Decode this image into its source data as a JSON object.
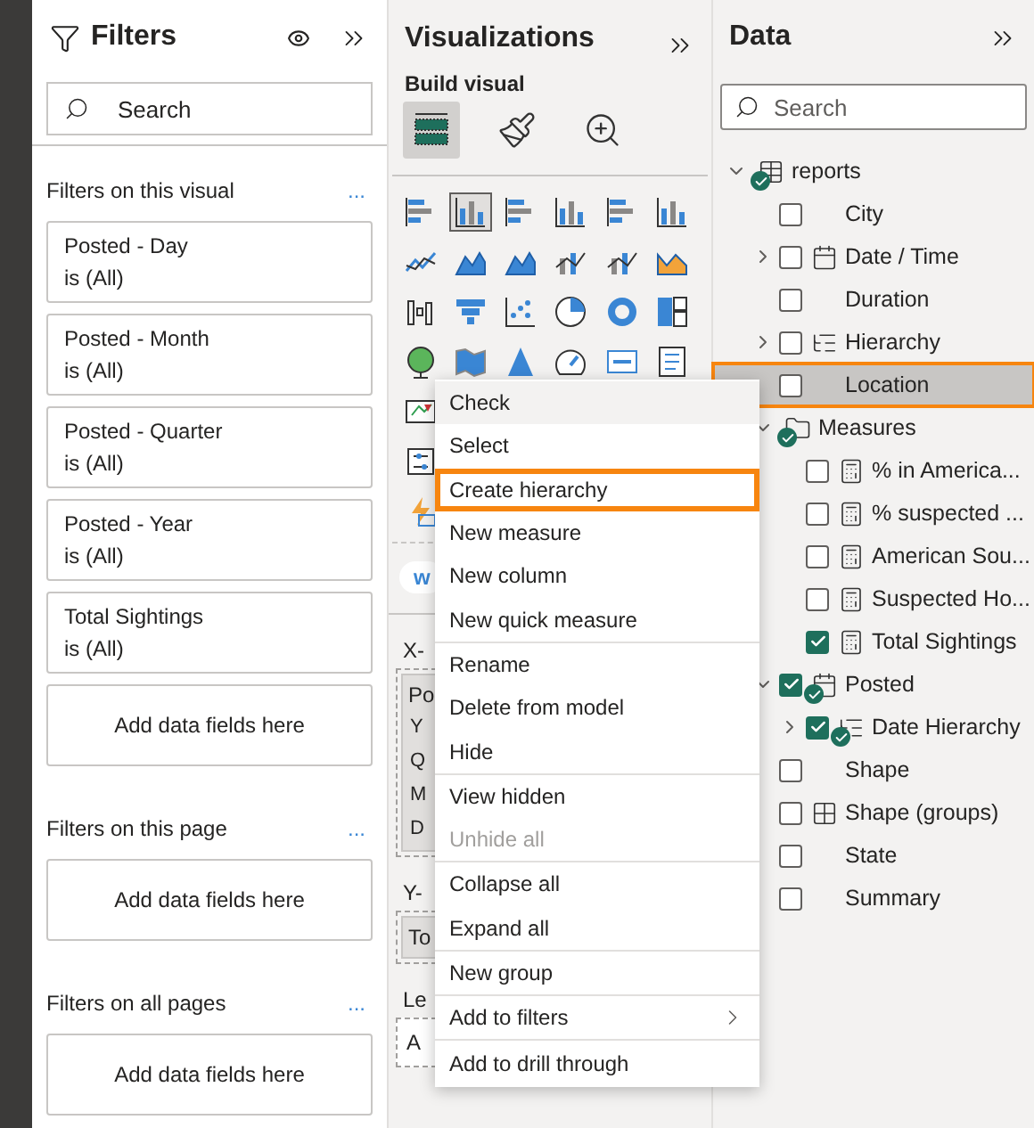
{
  "filters": {
    "title": "Filters",
    "search": {
      "placeholder": "Search"
    },
    "sections": [
      {
        "title": "Filters on this visual",
        "more": "...",
        "cards": [
          {
            "field": "Posted - Day",
            "condition": "is (All)"
          },
          {
            "field": "Posted - Month",
            "condition": "is (All)"
          },
          {
            "field": "Posted - Quarter",
            "condition": "is (All)"
          },
          {
            "field": "Posted - Year",
            "condition": "is (All)"
          },
          {
            "field": "Total Sightings",
            "condition": "is (All)"
          }
        ],
        "dropzone": "Add data fields here"
      },
      {
        "title": "Filters on this page",
        "more": "...",
        "dropzone": "Add data fields here"
      },
      {
        "title": "Filters on all pages",
        "more": "...",
        "dropzone": "Add data fields here"
      }
    ]
  },
  "visualizations": {
    "title": "Visualizations",
    "subtitle": "Build visual",
    "tabs": [
      {
        "kind": "fields",
        "selected": true
      },
      {
        "kind": "format",
        "selected": false
      },
      {
        "kind": "analytics",
        "selected": false
      }
    ],
    "visual_types": [
      [
        {
          "kind": "hbar",
          "selected": false
        },
        {
          "kind": "column",
          "selected": true
        },
        {
          "kind": "hbar",
          "selected": false
        },
        {
          "kind": "column",
          "selected": false
        },
        {
          "kind": "hbar",
          "selected": false
        },
        {
          "kind": "column",
          "selected": false
        }
      ],
      [
        {
          "kind": "line",
          "selected": false
        },
        {
          "kind": "area",
          "selected": false
        },
        {
          "kind": "area",
          "selected": false
        },
        {
          "kind": "combo",
          "selected": false
        },
        {
          "kind": "combo",
          "selected": false
        },
        {
          "kind": "ribbon",
          "selected": false
        }
      ],
      [
        {
          "kind": "waterfall",
          "selected": false
        },
        {
          "kind": "funnel",
          "selected": false
        },
        {
          "kind": "scatter",
          "selected": false
        },
        {
          "kind": "pie",
          "selected": false
        },
        {
          "kind": "donut",
          "selected": false
        },
        {
          "kind": "treemap",
          "selected": false
        }
      ],
      [
        {
          "kind": "globe",
          "selected": false
        },
        {
          "kind": "map",
          "selected": false
        },
        {
          "kind": "triangle",
          "selected": false
        },
        {
          "kind": "gauge",
          "selected": false
        },
        {
          "kind": "card",
          "selected": false
        },
        {
          "kind": "multirow",
          "selected": false
        }
      ],
      [
        {
          "kind": "kpi",
          "selected": false
        }
      ],
      [
        {
          "kind": "slicer",
          "selected": false
        }
      ],
      [
        {
          "kind": "lightning",
          "selected": false
        }
      ]
    ],
    "chip": "w",
    "wells": [
      {
        "label": "X-",
        "kind": "field",
        "field": "Po",
        "sub": [
          "Y",
          "Q",
          "M",
          "D"
        ]
      },
      {
        "label": "Y-",
        "kind": "field",
        "field": "To"
      },
      {
        "label": "Le",
        "kind": "empty",
        "field": "A"
      }
    ]
  },
  "context_menu": {
    "groups": [
      [
        {
          "label": "Check",
          "hovered": true,
          "selected": false,
          "disabled": false
        },
        {
          "label": "Select",
          "hovered": false,
          "selected": false,
          "disabled": false
        },
        {
          "label": "Create hierarchy",
          "hovered": false,
          "selected": true,
          "disabled": false
        },
        {
          "label": "New measure",
          "hovered": false,
          "selected": false,
          "disabled": false
        },
        {
          "label": "New column",
          "hovered": false,
          "selected": false,
          "disabled": false
        },
        {
          "label": "New quick measure",
          "hovered": false,
          "selected": false,
          "disabled": false
        }
      ],
      [
        {
          "label": "Rename",
          "hovered": false,
          "selected": false,
          "disabled": false
        },
        {
          "label": "Delete from model",
          "hovered": false,
          "selected": false,
          "disabled": false
        },
        {
          "label": "Hide",
          "hovered": false,
          "selected": false,
          "disabled": false
        }
      ],
      [
        {
          "label": "View hidden",
          "hovered": false,
          "selected": false,
          "disabled": false
        },
        {
          "label": "Unhide all",
          "hovered": false,
          "selected": false,
          "disabled": true
        }
      ],
      [
        {
          "label": "Collapse all",
          "hovered": false,
          "selected": false,
          "disabled": false
        },
        {
          "label": "Expand all",
          "hovered": false,
          "selected": false,
          "disabled": false
        }
      ],
      [
        {
          "label": "New group",
          "hovered": false,
          "selected": false,
          "disabled": false
        }
      ],
      [
        {
          "label": "Add to filters",
          "hovered": false,
          "selected": false,
          "disabled": false,
          "submenu": true
        }
      ],
      [
        {
          "label": "Add to drill through",
          "hovered": false,
          "selected": false,
          "disabled": false
        }
      ]
    ]
  },
  "data": {
    "title": "Data",
    "search": {
      "placeholder": "Search"
    },
    "tree": [
      {
        "label": "reports",
        "kind": "table",
        "expanded": true,
        "used": true,
        "selected": false,
        "children": [
          {
            "label": "City",
            "kind": "field",
            "checked": false,
            "used": false,
            "selected": false
          },
          {
            "label": "Date / Time",
            "kind": "date",
            "expanded": false,
            "checked": false,
            "used": false,
            "selected": false
          },
          {
            "label": "Duration",
            "kind": "field",
            "checked": false,
            "used": false,
            "selected": false
          },
          {
            "label": "Hierarchy",
            "kind": "hierarchy",
            "expanded": false,
            "checked": false,
            "used": false,
            "selected": false
          },
          {
            "label": "Location",
            "kind": "field",
            "checked": false,
            "used": false,
            "selected": true
          },
          {
            "label": "Measures",
            "kind": "folder",
            "expanded": true,
            "used": true,
            "selected": false,
            "children": [
              {
                "label": "% in America...",
                "kind": "measure",
                "checked": false,
                "used": false,
                "selected": false
              },
              {
                "label": "% suspected ...",
                "kind": "measure",
                "checked": false,
                "used": false,
                "selected": false
              },
              {
                "label": "American Sou...",
                "kind": "measure",
                "checked": false,
                "used": false,
                "selected": false
              },
              {
                "label": "Suspected Ho...",
                "kind": "measure",
                "checked": false,
                "used": false,
                "selected": false
              },
              {
                "label": "Total Sightings",
                "kind": "measure",
                "checked": true,
                "used": false,
                "selected": false
              }
            ]
          },
          {
            "label": "Posted",
            "kind": "date",
            "expanded": true,
            "checked": true,
            "used": true,
            "selected": false,
            "children": [
              {
                "label": "Date Hierarchy",
                "kind": "hierarchy",
                "expanded": false,
                "checked": true,
                "used": true,
                "selected": false
              }
            ]
          },
          {
            "label": "Shape",
            "kind": "field",
            "checked": false,
            "used": false,
            "selected": false
          },
          {
            "label": "Shape (groups)",
            "kind": "group",
            "checked": false,
            "used": false,
            "selected": false
          },
          {
            "label": "State",
            "kind": "field",
            "checked": false,
            "used": false,
            "selected": false
          },
          {
            "label": "Summary",
            "kind": "field",
            "checked": false,
            "used": false,
            "selected": false
          }
        ]
      }
    ]
  }
}
